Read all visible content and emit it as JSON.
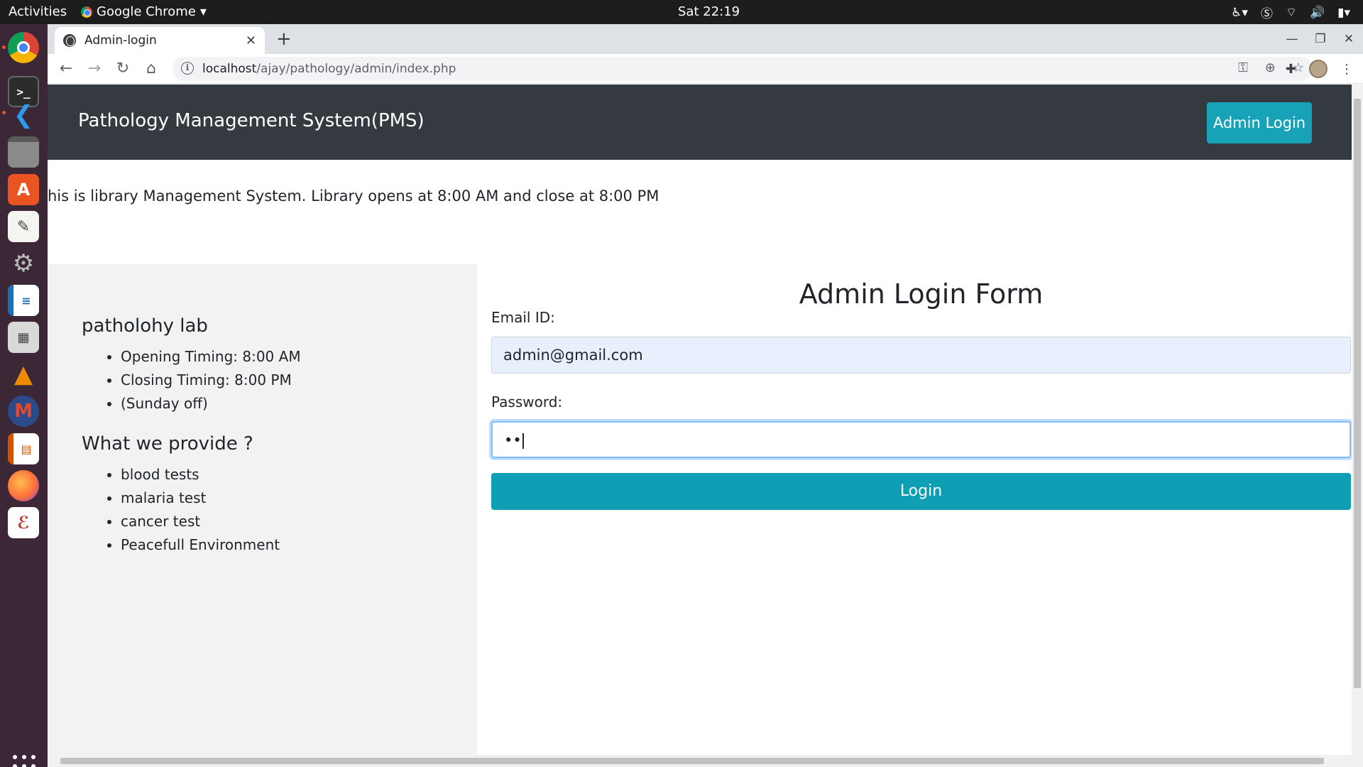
{
  "system": {
    "activities": "Activities",
    "app_name": "Google Chrome",
    "clock": "Sat 22:19"
  },
  "dock": {
    "items": [
      "Google Chrome",
      "Terminal",
      "Visual Studio Code",
      "Files",
      "Ubuntu Software",
      "Text Editor",
      "Settings",
      "LibreOffice Writer",
      "Calculator",
      "VLC",
      "Moodle",
      "LibreOffice Impress",
      "Firefox",
      "Evince"
    ]
  },
  "browser": {
    "tab_title": "Admin-login",
    "url_host": "localhost",
    "url_path": "/ajay/pathology/admin/index.php"
  },
  "site": {
    "brand": "Pathology Management System(PMS)",
    "admin_login_button": "Admin Login",
    "marquee_text": "his is library Management System. Library opens at 8:00 AM and close at 8:00 PM",
    "sidebar": {
      "lab_heading": "patholohy lab",
      "lab_items": [
        "Opening Timing: 8:00 AM",
        "Closing Timing: 8:00 PM",
        "(Sunday off)"
      ],
      "provide_heading": "What we provide ?",
      "provide_items": [
        "blood tests",
        "malaria test",
        "cancer test",
        "Peacefull Environment"
      ]
    },
    "form": {
      "title": "Admin Login Form",
      "email_label": "Email ID:",
      "email_value": "admin@gmail.com",
      "password_label": "Password:",
      "password_value": "••",
      "submit": "Login"
    }
  }
}
